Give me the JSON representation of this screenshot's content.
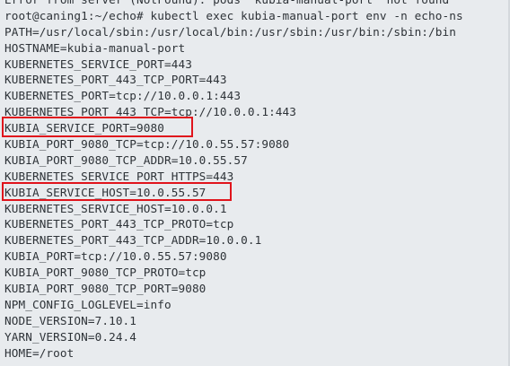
{
  "terminal": {
    "background": "#e8ebee",
    "text_color": "#2e3338",
    "highlight_color": "#e0141c",
    "lines": [
      "Error from server (NotFound): pods \"kubia-manual-port\" not found",
      "root@caning1:~/echo# kubectl exec kubia-manual-port env -n echo-ns",
      "PATH=/usr/local/sbin:/usr/local/bin:/usr/sbin:/usr/bin:/sbin:/bin",
      "HOSTNAME=kubia-manual-port",
      "KUBERNETES_SERVICE_PORT=443",
      "KUBERNETES_PORT_443_TCP_PORT=443",
      "KUBERNETES_PORT=tcp://10.0.0.1:443",
      "KUBERNETES_PORT_443_TCP=tcp://10.0.0.1:443",
      "KUBIA_SERVICE_PORT=9080",
      "KUBIA_PORT_9080_TCP=tcp://10.0.55.57:9080",
      "KUBIA_PORT_9080_TCP_ADDR=10.0.55.57",
      "KUBERNETES_SERVICE_PORT_HTTPS=443",
      "KUBIA_SERVICE_HOST=10.0.55.57",
      "KUBERNETES_SERVICE_HOST=10.0.0.1",
      "KUBERNETES_PORT_443_TCP_PROTO=tcp",
      "KUBERNETES_PORT_443_TCP_ADDR=10.0.0.1",
      "KUBIA_PORT=tcp://10.0.55.57:9080",
      "KUBIA_PORT_9080_TCP_PROTO=tcp",
      "KUBIA_PORT_9080_TCP_PORT=9080",
      "NPM_CONFIG_LOGLEVEL=info",
      "NODE_VERSION=7.10.1",
      "YARN_VERSION=0.24.4",
      "HOME=/root"
    ]
  }
}
